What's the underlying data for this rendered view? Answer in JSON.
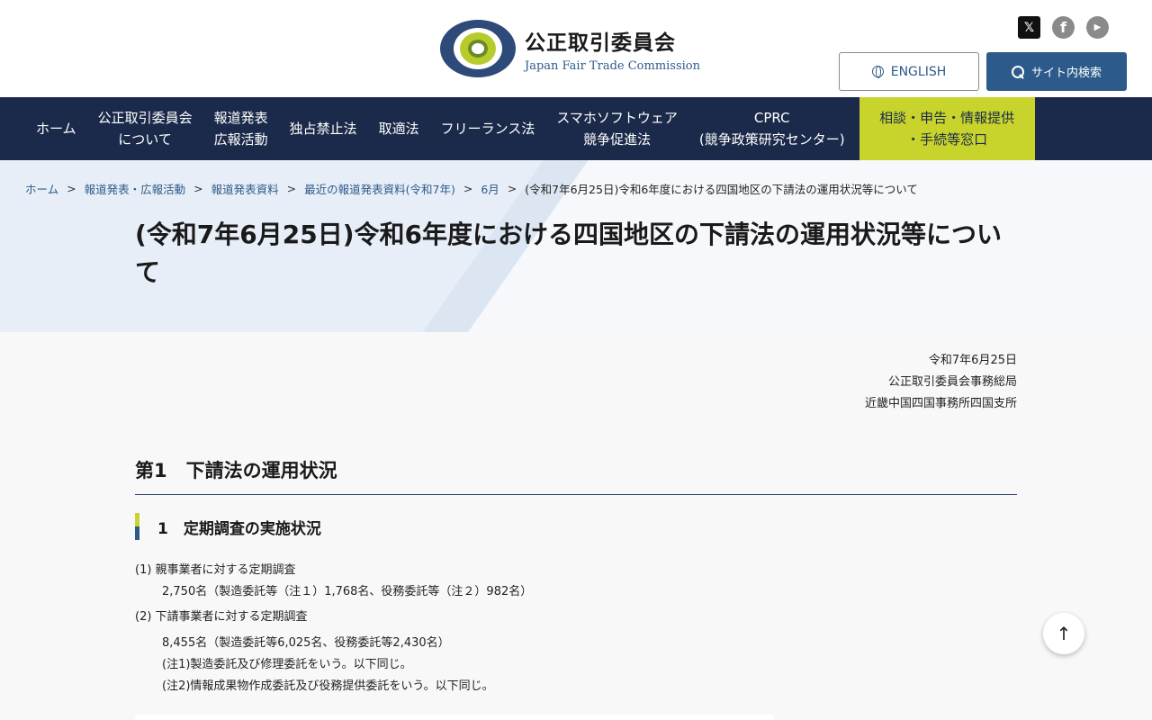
{
  "header": {
    "logo_ja": "公正取引委員会",
    "logo_en": "Japan Fair Trade Commission",
    "social": [
      {
        "icon": "x-icon",
        "glyph": "𝕏"
      },
      {
        "icon": "facebook-icon",
        "glyph": "f"
      },
      {
        "icon": "youtube-icon",
        "glyph": "▶"
      }
    ],
    "english_label": "ENGLISH",
    "search_label": "サイト内検索"
  },
  "nav": {
    "items": [
      {
        "label": "ホーム"
      },
      {
        "label": "公正取引委員会\nについて"
      },
      {
        "label": "報道発表\n広報活動"
      },
      {
        "label": "独占禁止法"
      },
      {
        "label": "取適法"
      },
      {
        "label": "フリーランス法"
      },
      {
        "label": "スマホソフトウェア\n競争促進法"
      },
      {
        "label": "CPRC\n(競争政策研究センター)"
      }
    ],
    "cta_label": "相談・申告・情報提供\n・手続等窓口"
  },
  "breadcrumb": {
    "items": [
      "ホーム",
      "報道発表・広報活動",
      "報道発表資料",
      "最近の報道発表資料(令和7年)",
      "6月"
    ],
    "separator": ">",
    "current": "(令和7年6月25日)令和6年度における四国地区の下請法の運用状況等について"
  },
  "page_title": "(令和7年6月25日)令和6年度における四国地区の下請法の運用状況等について",
  "doc_meta": {
    "date": "令和7年6月25日",
    "org": "公正取引委員会事務総局",
    "office": "近畿中国四国事務所四国支所"
  },
  "section": {
    "title": "第1　下請法の運用状況",
    "sub_title": "1　定期調査の実施状況",
    "p1_title": "(1) 親事業者に対する定期調査",
    "p1_body": "2,750名（製造委託等（注１）1,768名、役務委託等（注２）982名）",
    "p2_title": "(2) 下請事業者に対する定期調査",
    "p2_body": "8,455名（製造委託等6,025名、役務委託等2,430名）",
    "note1": "(注1)製造委託及び修理委託をいう。以下同じ。",
    "note2": "(注2)情報成果物作成委託及び役務提供委託をいう。以下同じ。"
  },
  "scroll_top_glyph": "↑",
  "colors": {
    "nav_bg": "#1b2a4a",
    "accent_lime": "#c8d42c",
    "primary_blue": "#2c5a8a"
  }
}
